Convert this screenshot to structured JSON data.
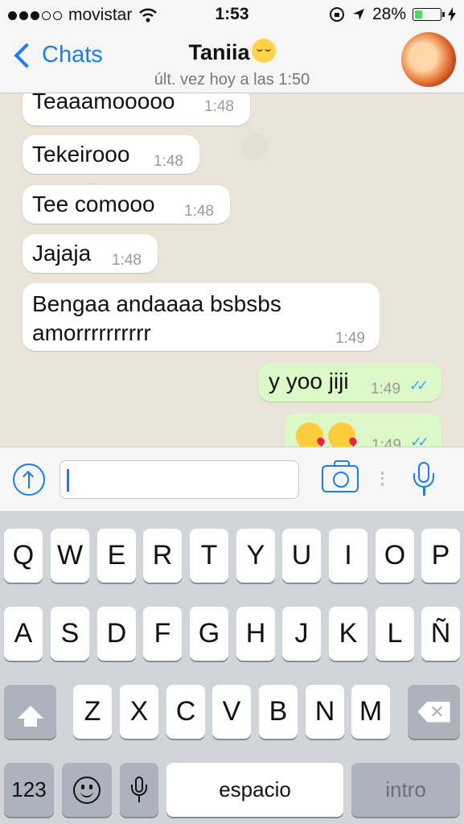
{
  "status_bar": {
    "carrier": "movistar",
    "time": "1:53",
    "battery_percent": "28%"
  },
  "nav": {
    "back_label": "Chats",
    "contact_name": "Taniia",
    "last_seen": "últ. vez hoy a las 1:50"
  },
  "messages": [
    {
      "text": "Teaaamooooo",
      "time": "1:48",
      "direction": "in"
    },
    {
      "text": "Tekeirooo",
      "time": "1:48",
      "direction": "in"
    },
    {
      "text": "Tee comooo",
      "time": "1:48",
      "direction": "in"
    },
    {
      "text": "Jajaja",
      "time": "1:48",
      "direction": "in"
    },
    {
      "text": "Bengaa andaaaa bsbsbs amorrrrrrrrrr",
      "time": "1:49",
      "direction": "in"
    },
    {
      "text": "y yoo jiji",
      "time": "1:49",
      "direction": "out",
      "read": true
    },
    {
      "text": "",
      "time": "1:49",
      "direction": "out",
      "read": true,
      "emoji": [
        "kissing-heart-emoji",
        "kissing-heart-emoji"
      ]
    }
  ],
  "input": {
    "value": "",
    "placeholder": ""
  },
  "keyboard": {
    "row1": [
      "Q",
      "W",
      "E",
      "R",
      "T",
      "Y",
      "U",
      "I",
      "O",
      "P"
    ],
    "row2": [
      "A",
      "S",
      "D",
      "F",
      "G",
      "H",
      "J",
      "K",
      "L",
      "Ñ"
    ],
    "row3": [
      "Z",
      "X",
      "C",
      "V",
      "B",
      "N",
      "M"
    ],
    "numbers_label": "123",
    "space_label": "espacio",
    "return_label": "intro"
  },
  "colors": {
    "accent": "#1a7cf3",
    "outgoing_bubble": "#dcf8c6",
    "read_ticks": "#3fa9f5",
    "battery": "#4cd964"
  }
}
